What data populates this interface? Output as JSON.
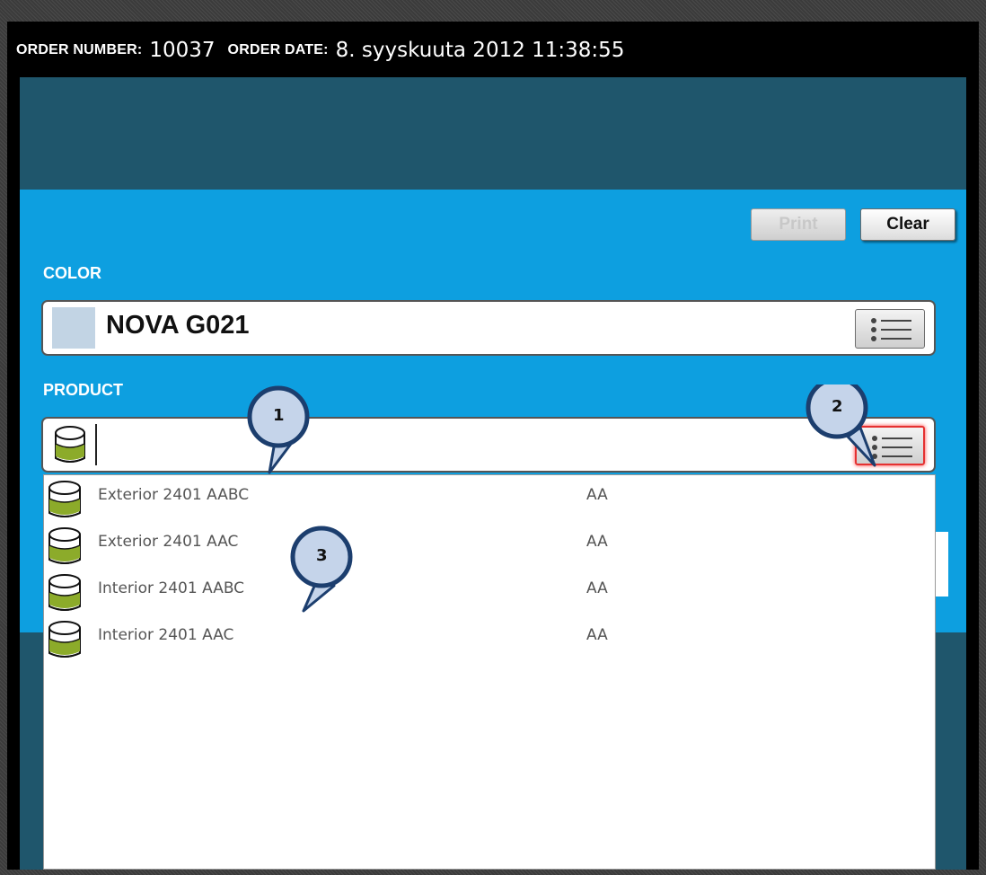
{
  "header": {
    "order_number_label": "ORDER NUMBER:",
    "order_number": "10037",
    "order_date_label": "ORDER DATE:",
    "order_date": "8. syyskuuta 2012 11:38:55"
  },
  "toolbar": {
    "print_label": "Print",
    "clear_label": "Clear"
  },
  "color": {
    "label": "COLOR",
    "value": "NOVA G021",
    "swatch_color": "#c2d4e4",
    "list_icon": "list-icon"
  },
  "product": {
    "label": "PRODUCT",
    "value": "",
    "icon": "paint-can-icon",
    "list_icon": "list-icon"
  },
  "dropdown": {
    "items": [
      {
        "name": "Exterior 2401 AABC",
        "code": "AA"
      },
      {
        "name": "Exterior 2401 AAC",
        "code": "AA"
      },
      {
        "name": "Interior 2401 AABC",
        "code": "AA"
      },
      {
        "name": "Interior 2401 AAC",
        "code": "AA"
      }
    ]
  },
  "callouts": [
    "1",
    "2",
    "3"
  ],
  "colors": {
    "header_bg": "#000000",
    "dark_band": "#1f566c",
    "panel_blue": "#0d9fe0",
    "highlight_red": "#e53131",
    "callout_fill": "#c5d4ea",
    "callout_border": "#1c3e6e"
  }
}
